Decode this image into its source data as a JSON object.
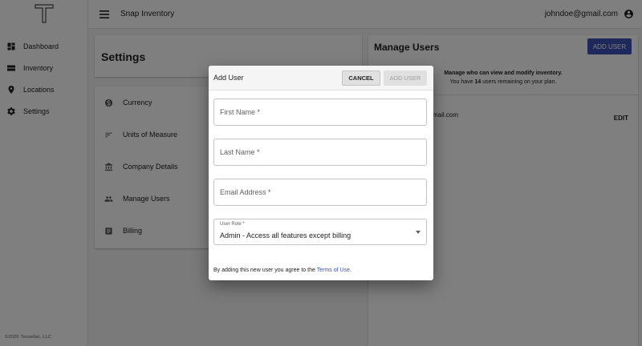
{
  "sidebar": {
    "items": [
      {
        "label": "Dashboard",
        "icon": "dashboard-icon"
      },
      {
        "label": "Inventory",
        "icon": "inventory-icon"
      },
      {
        "label": "Locations",
        "icon": "location-pin-icon"
      },
      {
        "label": "Settings",
        "icon": "gear-icon"
      }
    ],
    "copyright": "©2020 Tessellat, LLC"
  },
  "appbar": {
    "title": "Snap Inventory",
    "user_email": "johndoe@gmail.com"
  },
  "settings": {
    "title": "Settings",
    "items": [
      {
        "label": "Currency",
        "icon": "dollar-icon"
      },
      {
        "label": "Units of Measure",
        "icon": "sort-icon"
      },
      {
        "label": "Company Details",
        "icon": "building-icon"
      },
      {
        "label": "Manage Users",
        "icon": "people-icon"
      },
      {
        "label": "Billing",
        "icon": "receipt-icon"
      }
    ]
  },
  "manage_users": {
    "title": "Manage Users",
    "add_button": "ADD USER",
    "info_line1": "Manage who can view and modify inventory.",
    "info_prefix": "You have ",
    "users_remaining": "14",
    "info_suffix": " users remaining on your plan.",
    "row_email_partial": "mail.com",
    "row_edit": "EDIT"
  },
  "dialog": {
    "title": "Add User",
    "cancel_label": "CANCEL",
    "add_label": "ADD USER",
    "first_name_placeholder": "First Name *",
    "last_name_placeholder": "Last Name *",
    "email_placeholder": "Email Address *",
    "role_label": "User Role *",
    "role_value": "Admin - Access all features except billing",
    "terms_prefix": "By adding this new user you agree to the ",
    "terms_link": "Terms of Use",
    "terms_suffix": "."
  },
  "colors": {
    "primary": "#3f51b5",
    "overlay": "rgba(0,0,0,0.5)"
  }
}
